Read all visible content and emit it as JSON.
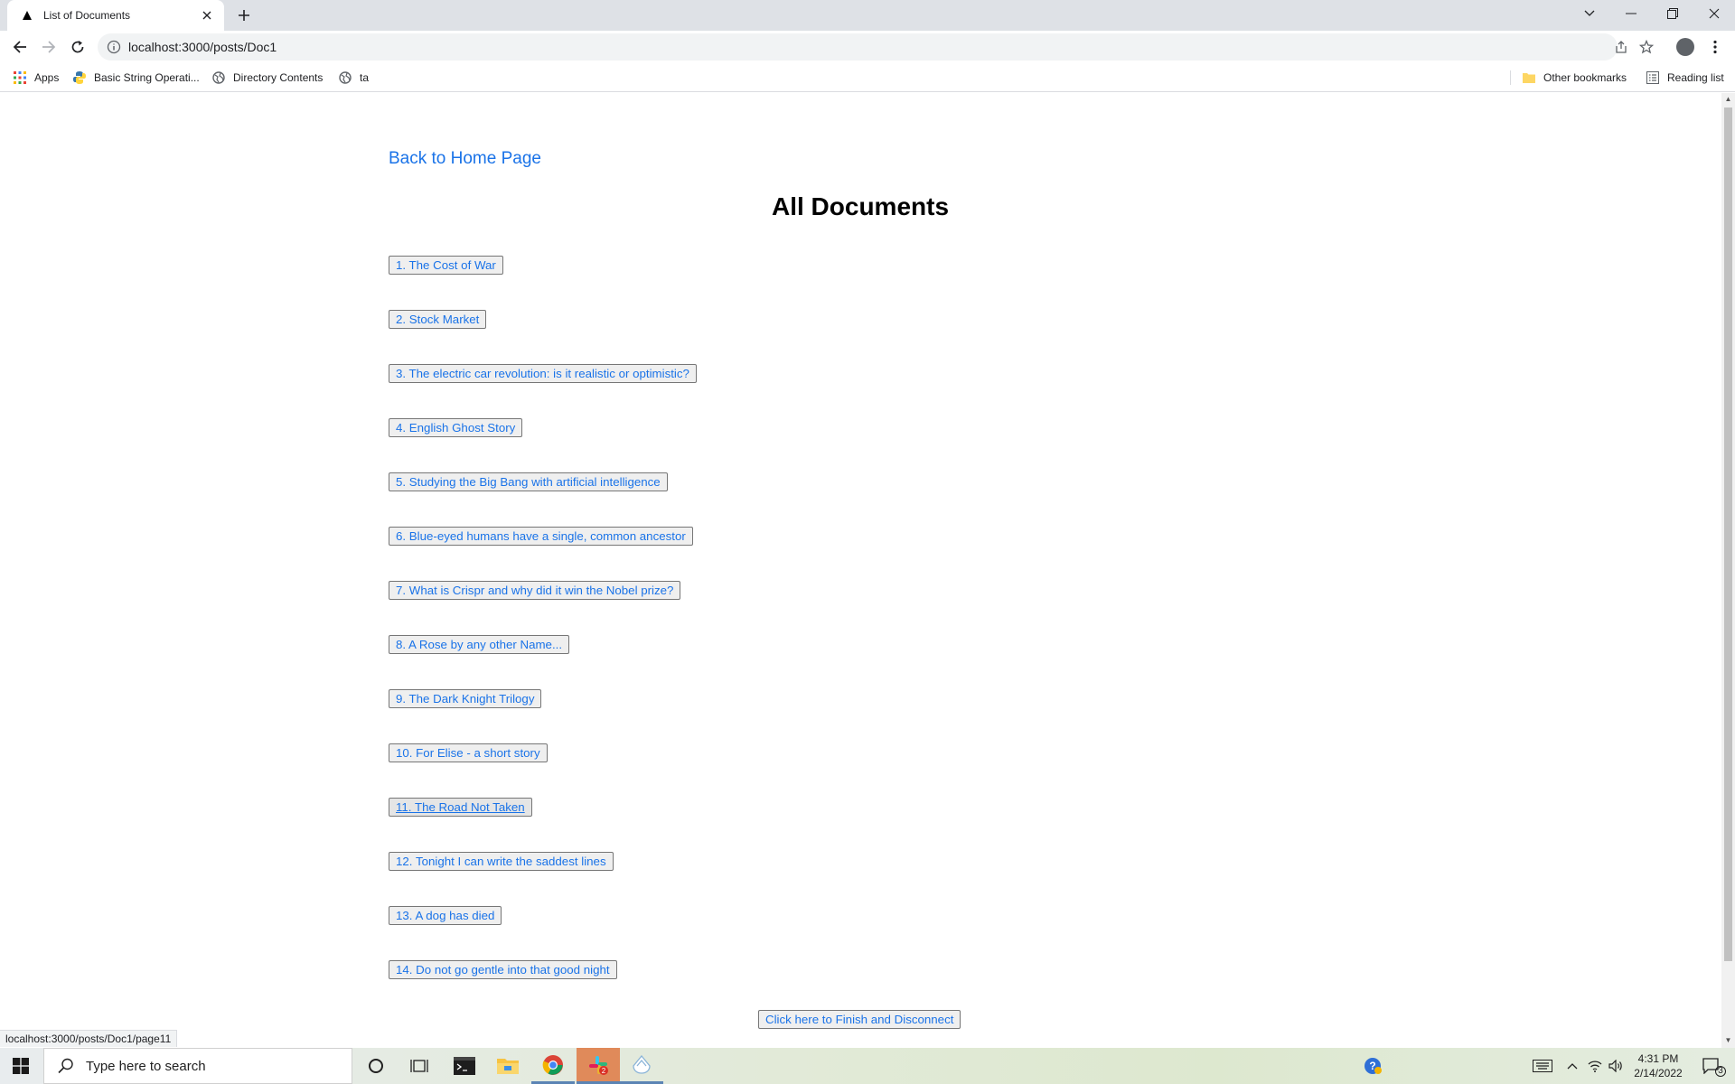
{
  "browser": {
    "tab_title": "List of Documents",
    "url": "localhost:3000/posts/Doc1",
    "bookmarks": [
      {
        "label": "Apps",
        "icon": "apps-grid-icon"
      },
      {
        "label": "Basic String Operati...",
        "icon": "python-icon"
      },
      {
        "label": "Directory Contents",
        "icon": "globe-icon"
      },
      {
        "label": "ta",
        "icon": "globe-icon"
      }
    ],
    "other_bookmarks": "Other bookmarks",
    "reading_list": "Reading list",
    "status_url": "localhost:3000/posts/Doc1/page11"
  },
  "page": {
    "back_link": "Back to Home Page",
    "heading": "All Documents",
    "documents": [
      "1. The Cost of War",
      "2. Stock Market",
      "3. The electric car revolution: is it realistic or optimistic?",
      "4. English Ghost Story",
      "5. Studying the Big Bang with artificial intelligence",
      "6. Blue-eyed humans have a single, common ancestor",
      "7. What is Crispr and why did it win the Nobel prize?",
      "8. A Rose by any other Name...",
      "9. The Dark Knight Trilogy",
      "10. For Elise - a short story",
      "11. The Road Not Taken",
      "12. Tonight I can write the saddest lines",
      "13. A dog has died",
      "14. Do not go gentle into that good night"
    ],
    "finish_button": "Click here to Finish and Disconnect"
  },
  "taskbar": {
    "search_placeholder": "Type here to search",
    "time": "4:31 PM",
    "date": "2/14/2022",
    "notification_count": "3",
    "colors": {
      "accent": "#1a73e8",
      "active_indicator": "#5b84b4"
    }
  }
}
